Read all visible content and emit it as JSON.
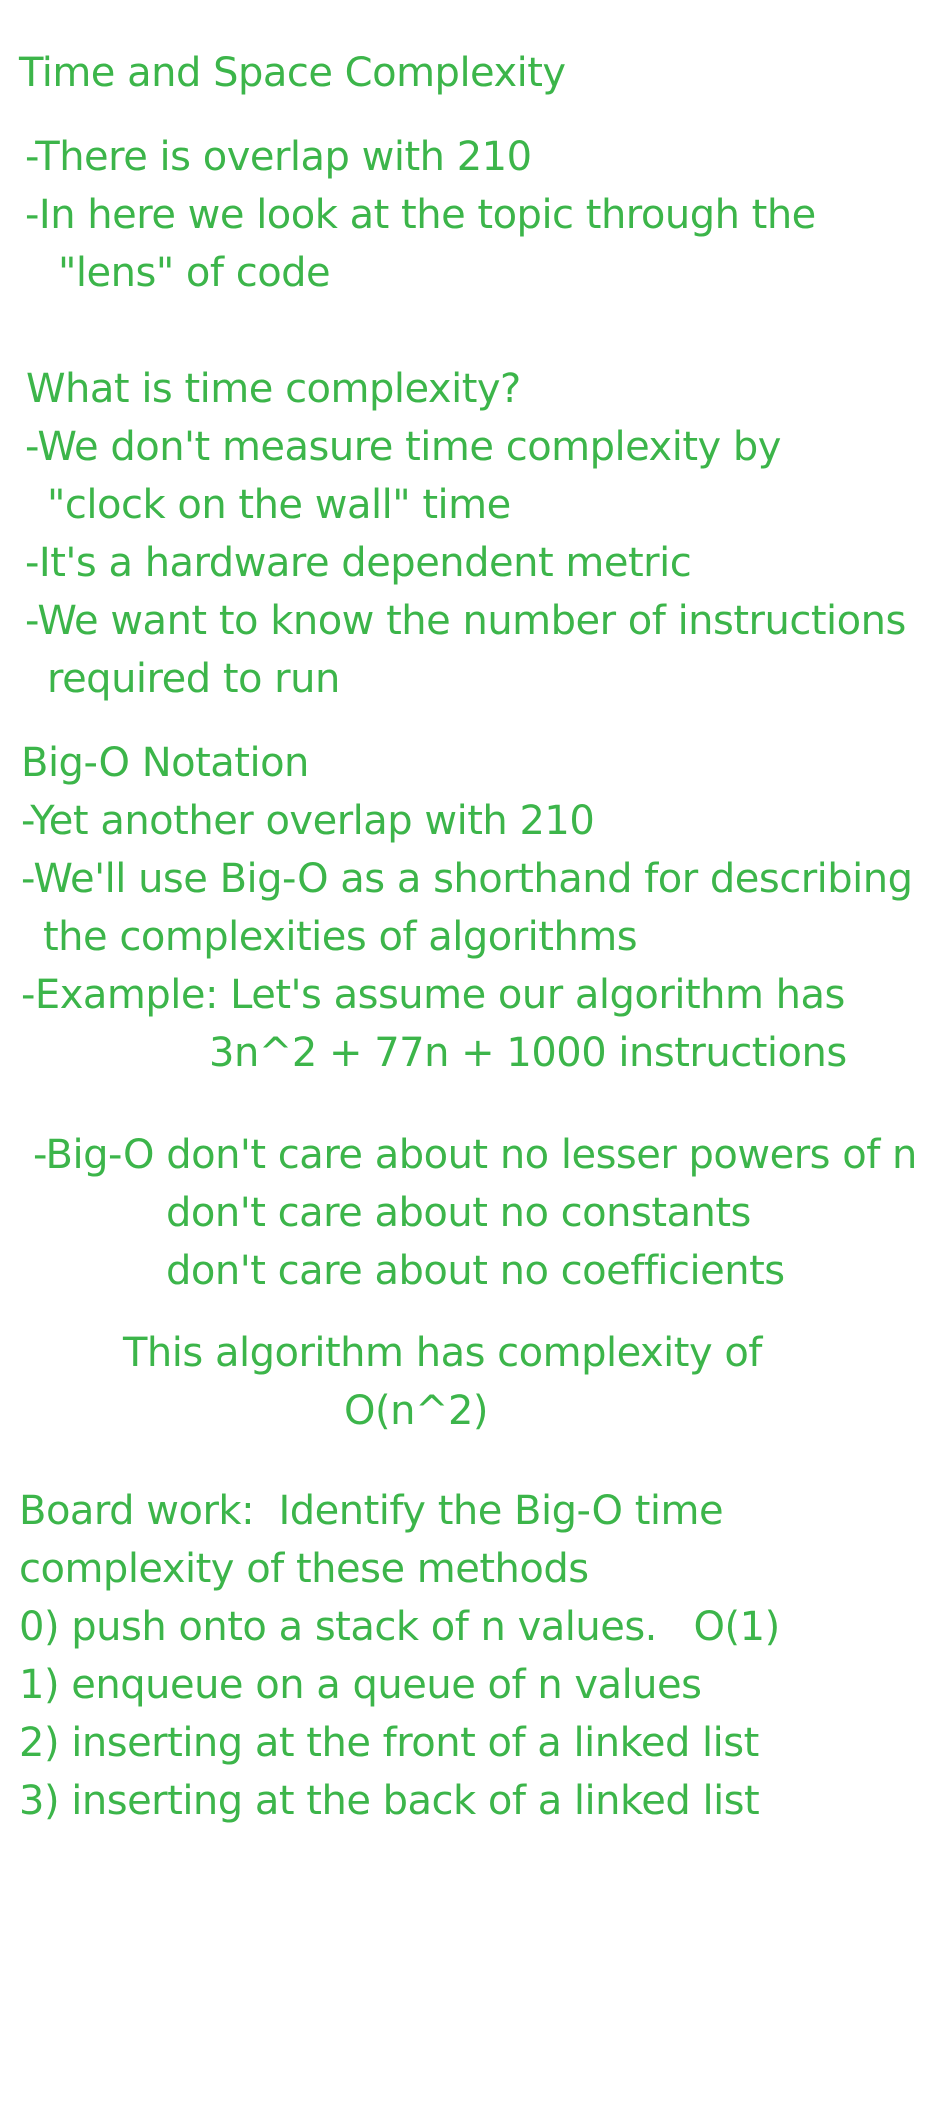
{
  "colors": {
    "text": "#3cb54a",
    "background": "#ffffff"
  },
  "notes": {
    "title": "Time and Space Complexity",
    "overlap": {
      "line1": "-There is overlap with 210",
      "line2": "-In here we look at the topic through the",
      "line3": "\"lens\" of code"
    },
    "time": {
      "heading": "What is time complexity?",
      "line1": "-We don't measure time complexity by",
      "line2": "\"clock on the wall\" time",
      "line3": "-It's a hardware dependent metric",
      "line4": "-We want to know the number of instructions",
      "line5": "required to run"
    },
    "bigo": {
      "heading": "Big-O Notation",
      "line1": "-Yet another overlap with 210",
      "line2": "-We'll use Big-O as a shorthand for describing",
      "line3": "the complexities of algorithms",
      "line4": "-Example: Let's assume our algorithm has",
      "line5": "3n^2 + 77n + 1000 instructions"
    },
    "rules": {
      "line1": "-Big-O don't care about no lesser powers of n",
      "line2": "don't care about no constants",
      "line3": "don't care about no coefficients"
    },
    "conclusion": {
      "line1": "This algorithm has complexity of",
      "line2": "O(n^2)"
    },
    "board": {
      "line1": "Board work:  Identify the Big-O time",
      "line2": "complexity of these methods",
      "items": [
        "0) push onto a stack of n values.   O(1)",
        "1) enqueue on a queue of n values",
        "2) inserting at the front of a linked list",
        "3) inserting at the back of a linked list"
      ]
    }
  }
}
